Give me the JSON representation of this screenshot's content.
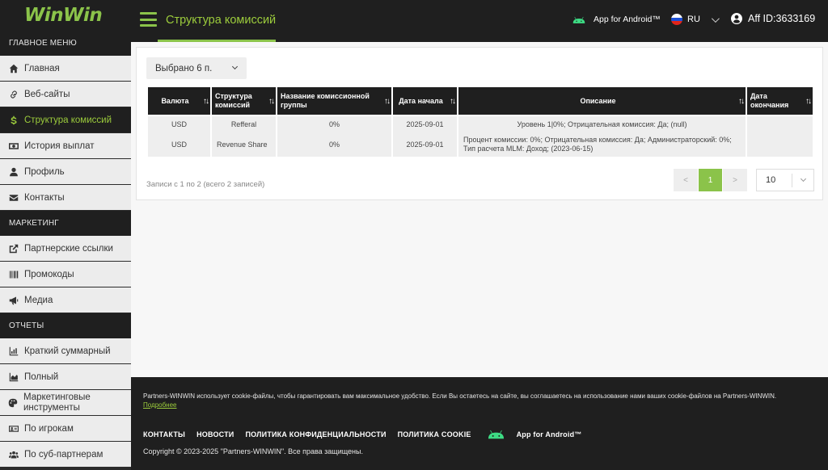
{
  "brand": {
    "logo": "WinWin",
    "accent": "#8bc34a"
  },
  "sidebar": {
    "sections": [
      {
        "label": "ГЛАВНОЕ МЕНЮ"
      },
      {
        "label": "МАРКЕТИНГ"
      },
      {
        "label": "ОТЧЕТЫ"
      }
    ],
    "items": [
      {
        "label": "Главная",
        "icon": "home-icon"
      },
      {
        "label": "Веб-сайты",
        "icon": "link-icon"
      },
      {
        "label": "Структура комиссий",
        "icon": "dollar-icon",
        "active": true
      },
      {
        "label": "История выплат",
        "icon": "money-icon"
      },
      {
        "label": "Профиль",
        "icon": "user-icon"
      },
      {
        "label": "Контакты",
        "icon": "envelope-icon"
      },
      {
        "label": "Партнерские ссылки",
        "icon": "external-link-icon"
      },
      {
        "label": "Промокоды",
        "icon": "barcode-icon"
      },
      {
        "label": "Медиа",
        "icon": "bullhorn-icon"
      },
      {
        "label": "Краткий суммарный",
        "icon": "chart-icon"
      },
      {
        "label": "Полный",
        "icon": "area-chart-icon"
      },
      {
        "label": "Маркетинговые инструменты",
        "icon": "palette-icon"
      },
      {
        "label": "По игрокам",
        "icon": "id-card-icon"
      },
      {
        "label": "По суб-партнерам",
        "icon": "users-icon"
      }
    ]
  },
  "header": {
    "title": "Структура комиссий",
    "android_label": "App for Android™",
    "language": "RU",
    "account": "Aff ID:3633169"
  },
  "filter": {
    "label": "Выбрано 6 п."
  },
  "table": {
    "columns": [
      "Валюта",
      "Структура комиссий",
      "Название комиссионной группы",
      "Дата начала",
      "Описание",
      "Дата окончания"
    ],
    "rows": [
      [
        "USD",
        "Refferal",
        "0%",
        "2025-09-01",
        "Уровень 1|0%; Отрицательная комиссия: Да; (null)",
        ""
      ],
      [
        "USD",
        "Revenue Share",
        "0%",
        "2025-09-01",
        "Процент комиссии: 0%; Отрицательная комиссия: Да; Администраторский: 0%; Тип расчета MLM: Доход; (2023-06-15)",
        ""
      ]
    ]
  },
  "pagination": {
    "records": "Записи с 1 по 2 (всего 2 записей)",
    "prev": "<",
    "current": "1",
    "next": ">",
    "per_page": "10"
  },
  "footer": {
    "cookie_text": "Partners-WINWIN использует cookie-файлы, чтобы гарантировать вам максимальное удобство. Если Вы остаетесь на сайте, вы соглашаетесь на использование нами ваших cookie-файлов на Partners-WINWIN.",
    "cookie_link": "Подробнее",
    "links": [
      "КОНТАКТЫ",
      "НОВОСТИ",
      "ПОЛИТИКА КОНФИДЕНЦИАЛЬНОСТИ",
      "ПОЛИТИКА COOKIE"
    ],
    "android_label": "App for Android™",
    "copyright": "Copyright © 2023-2025 \"Partners-WINWIN\". Все права защищены."
  }
}
